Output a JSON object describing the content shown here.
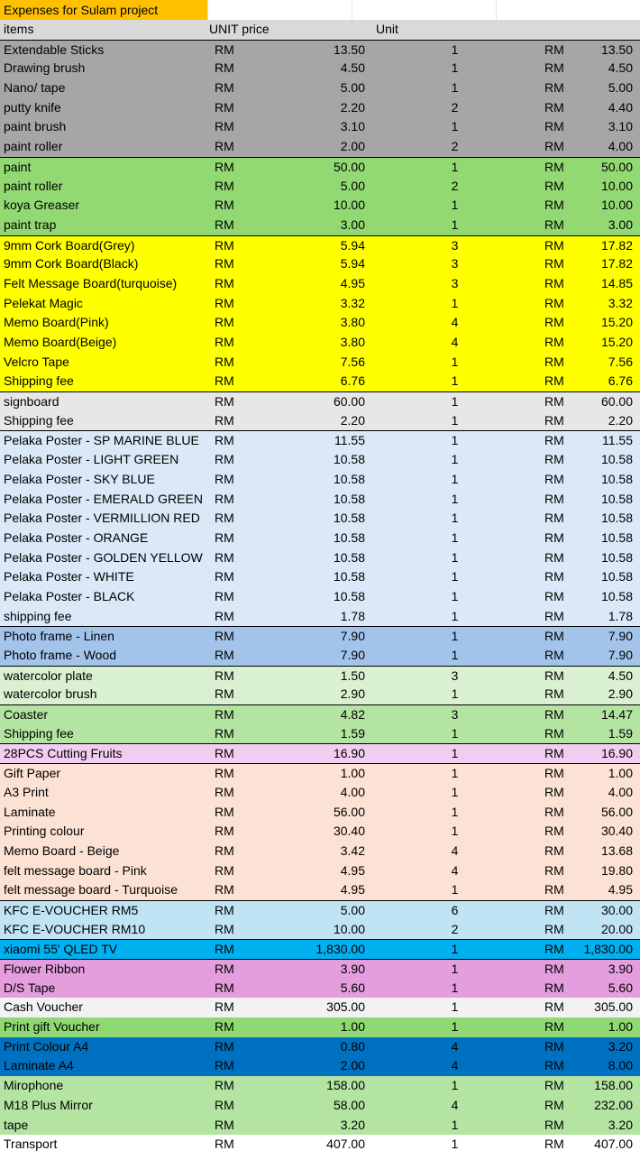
{
  "sheet": {
    "title": "Expenses for Sulam project",
    "headers": {
      "items": "items",
      "unit_price": "UNIT price",
      "unit": "Unit"
    },
    "rows": [
      {
        "item": "Extendable Sticks",
        "cur": "RM",
        "price": "13.50",
        "qty": "1",
        "cur2": "RM",
        "total": "13.50",
        "bg": "#a6a6a6",
        "top": true
      },
      {
        "item": "Drawing brush",
        "cur": "RM",
        "price": "4.50",
        "qty": "1",
        "cur2": "RM",
        "total": "4.50",
        "bg": "#a6a6a6"
      },
      {
        "item": "Nano/ tape",
        "cur": "RM",
        "price": "5.00",
        "qty": "1",
        "cur2": "RM",
        "total": "5.00",
        "bg": "#a6a6a6"
      },
      {
        "item": "putty knife",
        "cur": "RM",
        "price": "2.20",
        "qty": "2",
        "cur2": "RM",
        "total": "4.40",
        "bg": "#a6a6a6"
      },
      {
        "item": "paint brush",
        "cur": "RM",
        "price": "3.10",
        "qty": "1",
        "cur2": "RM",
        "total": "3.10",
        "bg": "#a6a6a6"
      },
      {
        "item": "paint roller",
        "cur": "RM",
        "price": "2.00",
        "qty": "2",
        "cur2": "RM",
        "total": "4.00",
        "bg": "#a6a6a6"
      },
      {
        "item": "paint",
        "cur": "RM",
        "price": "50.00",
        "qty": "1",
        "cur2": "RM",
        "total": "50.00",
        "bg": "#92d973",
        "top": true
      },
      {
        "item": "paint roller",
        "cur": "RM",
        "price": "5.00",
        "qty": "2",
        "cur2": "RM",
        "total": "10.00",
        "bg": "#92d973"
      },
      {
        "item": "koya Greaser",
        "cur": "RM",
        "price": "10.00",
        "qty": "1",
        "cur2": "RM",
        "total": "10.00",
        "bg": "#92d973"
      },
      {
        "item": "paint trap",
        "cur": "RM",
        "price": "3.00",
        "qty": "1",
        "cur2": "RM",
        "total": "3.00",
        "bg": "#92d973"
      },
      {
        "item": "9mm Cork Board(Grey)",
        "cur": "RM",
        "price": "5.94",
        "qty": "3",
        "cur2": "RM",
        "total": "17.82",
        "bg": "#ffff00",
        "top": true
      },
      {
        "item": "9mm Cork Board(Black)",
        "cur": "RM",
        "price": "5.94",
        "qty": "3",
        "cur2": "RM",
        "total": "17.82",
        "bg": "#ffff00"
      },
      {
        "item": "Felt Message Board(turquoise)",
        "cur": "RM",
        "price": "4.95",
        "qty": "3",
        "cur2": "RM",
        "total": "14.85",
        "bg": "#ffff00"
      },
      {
        "item": "Pelekat Magic",
        "cur": "RM",
        "price": "3.32",
        "qty": "1",
        "cur2": "RM",
        "total": "3.32",
        "bg": "#ffff00"
      },
      {
        "item": "Memo Board(Pink)",
        "cur": "RM",
        "price": "3.80",
        "qty": "4",
        "cur2": "RM",
        "total": "15.20",
        "bg": "#ffff00"
      },
      {
        "item": "Memo Board(Beige)",
        "cur": "RM",
        "price": "3.80",
        "qty": "4",
        "cur2": "RM",
        "total": "15.20",
        "bg": "#ffff00"
      },
      {
        "item": "Velcro Tape",
        "cur": "RM",
        "price": "7.56",
        "qty": "1",
        "cur2": "RM",
        "total": "7.56",
        "bg": "#ffff00"
      },
      {
        "item": "Shipping fee",
        "cur": "RM",
        "price": "6.76",
        "qty": "1",
        "cur2": "RM",
        "total": "6.76",
        "bg": "#ffff00"
      },
      {
        "item": "signboard",
        "cur": "RM",
        "price": "60.00",
        "qty": "1",
        "cur2": "RM",
        "total": "60.00",
        "bg": "#e7e7e7",
        "top": true
      },
      {
        "item": "Shipping fee",
        "cur": "RM",
        "price": "2.20",
        "qty": "1",
        "cur2": "RM",
        "total": "2.20",
        "bg": "#e7e7e7"
      },
      {
        "item": "Pelaka Poster - SP MARINE BLUE",
        "cur": "RM",
        "price": "11.55",
        "qty": "1",
        "cur2": "RM",
        "total": "11.55",
        "bg": "#dae8f7",
        "top": true
      },
      {
        "item": "Pelaka Poster - LIGHT GREEN",
        "cur": "RM",
        "price": "10.58",
        "qty": "1",
        "cur2": "RM",
        "total": "10.58",
        "bg": "#dae8f7"
      },
      {
        "item": "Pelaka Poster - SKY BLUE",
        "cur": "RM",
        "price": "10.58",
        "qty": "1",
        "cur2": "RM",
        "total": "10.58",
        "bg": "#dae8f7"
      },
      {
        "item": "Pelaka Poster - EMERALD GREEN",
        "cur": "RM",
        "price": "10.58",
        "qty": "1",
        "cur2": "RM",
        "total": "10.58",
        "bg": "#dae8f7"
      },
      {
        "item": "Pelaka Poster - VERMILLION RED",
        "cur": "RM",
        "price": "10.58",
        "qty": "1",
        "cur2": "RM",
        "total": "10.58",
        "bg": "#dae8f7"
      },
      {
        "item": "Pelaka Poster - ORANGE",
        "cur": "RM",
        "price": "10.58",
        "qty": "1",
        "cur2": "RM",
        "total": "10.58",
        "bg": "#dae8f7"
      },
      {
        "item": "Pelaka Poster - GOLDEN YELLOW",
        "cur": "RM",
        "price": "10.58",
        "qty": "1",
        "cur2": "RM",
        "total": "10.58",
        "bg": "#dae8f7"
      },
      {
        "item": "Pelaka Poster - WHITE",
        "cur": "RM",
        "price": "10.58",
        "qty": "1",
        "cur2": "RM",
        "total": "10.58",
        "bg": "#dae8f7"
      },
      {
        "item": "Pelaka Poster - BLACK",
        "cur": "RM",
        "price": "10.58",
        "qty": "1",
        "cur2": "RM",
        "total": "10.58",
        "bg": "#dae8f7"
      },
      {
        "item": "shipping fee",
        "cur": "RM",
        "price": "1.78",
        "qty": "1",
        "cur2": "RM",
        "total": "1.78",
        "bg": "#dae8f7"
      },
      {
        "item": "Photo frame - Linen",
        "cur": "RM",
        "price": "7.90",
        "qty": "1",
        "cur2": "RM",
        "total": "7.90",
        "bg": "#a3c4ea",
        "top": true
      },
      {
        "item": "Photo frame - Wood",
        "cur": "RM",
        "price": "7.90",
        "qty": "1",
        "cur2": "RM",
        "total": "7.90",
        "bg": "#a3c4ea"
      },
      {
        "item": "watercolor plate",
        "cur": "RM",
        "price": "1.50",
        "qty": "3",
        "cur2": "RM",
        "total": "4.50",
        "bg": "#daf1d1",
        "top": true
      },
      {
        "item": "watercolor brush",
        "cur": "RM",
        "price": "2.90",
        "qty": "1",
        "cur2": "RM",
        "total": "2.90",
        "bg": "#daf1d1"
      },
      {
        "item": "Coaster",
        "cur": "RM",
        "price": "4.82",
        "qty": "3",
        "cur2": "RM",
        "total": "14.47",
        "bg": "#b4e4a1",
        "top": true
      },
      {
        "item": "Shipping fee",
        "cur": "RM",
        "price": "1.59",
        "qty": "1",
        "cur2": "RM",
        "total": "1.59",
        "bg": "#b4e4a1"
      },
      {
        "item": "28PCS Cutting Fruits",
        "cur": "RM",
        "price": "16.90",
        "qty": "1",
        "cur2": "RM",
        "total": "16.90",
        "bg": "#f2cdf1",
        "top": true
      },
      {
        "item": "Gift Paper",
        "cur": "RM",
        "price": "1.00",
        "qty": "1",
        "cur2": "RM",
        "total": "1.00",
        "bg": "#fbe2d5",
        "top": true
      },
      {
        "item": "A3 Print",
        "cur": "RM",
        "price": "4.00",
        "qty": "1",
        "cur2": "RM",
        "total": "4.00",
        "bg": "#fbe2d5"
      },
      {
        "item": "Laminate",
        "cur": "RM",
        "price": "56.00",
        "qty": "1",
        "cur2": "RM",
        "total": "56.00",
        "bg": "#fbe2d5"
      },
      {
        "item": "Printing colour",
        "cur": "RM",
        "price": "30.40",
        "qty": "1",
        "cur2": "RM",
        "total": "30.40",
        "bg": "#fbe2d5"
      },
      {
        "item": "Memo Board - Beige",
        "cur": "RM",
        "price": "3.42",
        "qty": "4",
        "cur2": "RM",
        "total": "13.68",
        "bg": "#fbe2d5"
      },
      {
        "item": "felt message board - Pink",
        "cur": "RM",
        "price": "4.95",
        "qty": "4",
        "cur2": "RM",
        "total": "19.80",
        "bg": "#fbe2d5"
      },
      {
        "item": "felt message board - Turquoise",
        "cur": "RM",
        "price": "4.95",
        "qty": "1",
        "cur2": "RM",
        "total": "4.95",
        "bg": "#fbe2d5"
      },
      {
        "item": "KFC E-VOUCHER RM5",
        "cur": "RM",
        "price": "5.00",
        "qty": "6",
        "cur2": "RM",
        "total": "30.00",
        "bg": "#c1e4f5",
        "top": true
      },
      {
        "item": "KFC E-VOUCHER RM10",
        "cur": "RM",
        "price": "10.00",
        "qty": "2",
        "cur2": "RM",
        "total": "20.00",
        "bg": "#c1e4f5"
      },
      {
        "item": "xiaomi 55' QLED TV",
        "cur": "RM",
        "price": "1,830.00",
        "qty": "1",
        "cur2": "RM",
        "total": "1,830.00",
        "bg": "#00b0f0",
        "top": true
      },
      {
        "item": "Flower Ribbon",
        "cur": "RM",
        "price": "3.90",
        "qty": "1",
        "cur2": "RM",
        "total": "3.90",
        "bg": "#e59edd",
        "top": true
      },
      {
        "item": "D/S Tape",
        "cur": "RM",
        "price": "5.60",
        "qty": "1",
        "cur2": "RM",
        "total": "5.60",
        "bg": "#e59edd"
      },
      {
        "item": "Cash Voucher",
        "cur": "RM",
        "price": "305.00",
        "qty": "1",
        "cur2": "RM",
        "total": "305.00",
        "bg": "#f2f2f2"
      },
      {
        "item": "Print gift Voucher",
        "cur": "RM",
        "price": "1.00",
        "qty": "1",
        "cur2": "RM",
        "total": "1.00",
        "bg": "#8ed973"
      },
      {
        "item": "Print Colour A4",
        "cur": "RM",
        "price": "0.80",
        "qty": "4",
        "cur2": "RM",
        "total": "3.20",
        "bg": "#0070c0"
      },
      {
        "item": "Laminate A4",
        "cur": "RM",
        "price": "2.00",
        "qty": "4",
        "cur2": "RM",
        "total": "8.00",
        "bg": "#0070c0"
      },
      {
        "item": "Mirophone",
        "cur": "RM",
        "price": "158.00",
        "qty": "1",
        "cur2": "RM",
        "total": "158.00",
        "bg": "#b4e4a1"
      },
      {
        "item": "M18 Plus Mirror",
        "cur": "RM",
        "price": "58.00",
        "qty": "4",
        "cur2": "RM",
        "total": "232.00",
        "bg": "#b4e4a1"
      },
      {
        "item": "tape",
        "cur": "RM",
        "price": "3.20",
        "qty": "1",
        "cur2": "RM",
        "total": "3.20",
        "bg": "#b4e4a1"
      },
      {
        "item": "Transport",
        "cur": "RM",
        "price": "407.00",
        "qty": "1",
        "cur2": "RM",
        "total": "407.00",
        "bg": "#ffffff"
      }
    ]
  }
}
